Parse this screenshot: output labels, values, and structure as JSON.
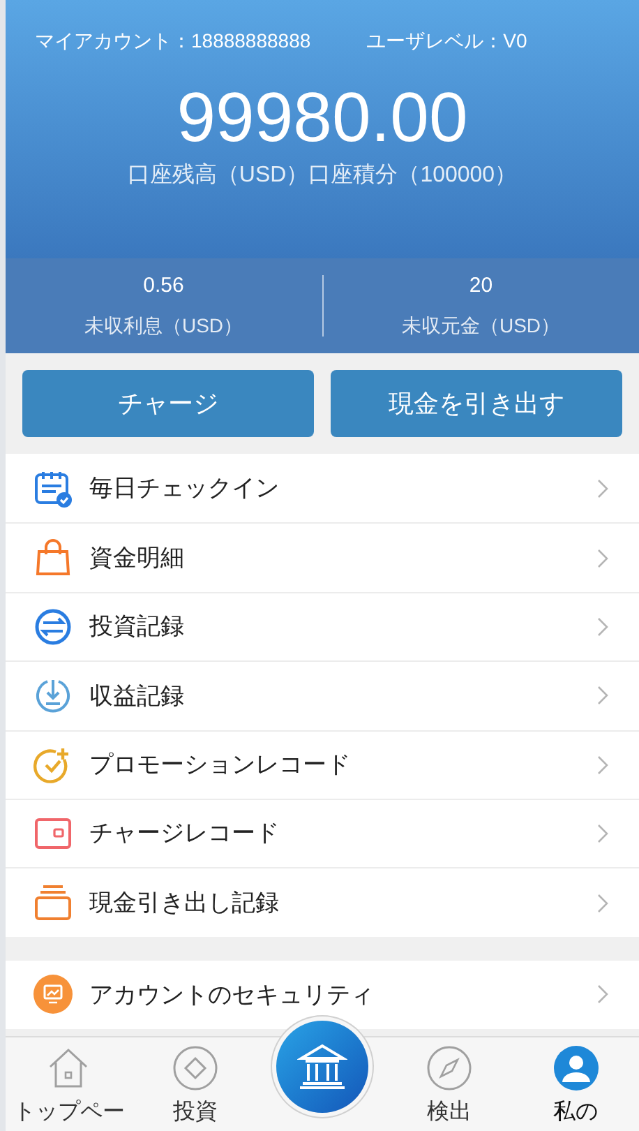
{
  "account": {
    "label": "マイアカウント：",
    "number": "18888888888",
    "level_label": "ユーザレベル：",
    "level": "V0"
  },
  "balance": {
    "amount": "99980.00",
    "caption": "口座残高（USD）口座積分（100000）"
  },
  "stats": [
    {
      "value": "0.56",
      "label": "未収利息（USD）"
    },
    {
      "value": "20",
      "label": "未収元金（USD）"
    }
  ],
  "actions": [
    "チャージ",
    "現金を引き出す"
  ],
  "menu_groups": [
    [
      {
        "label": "毎日チェックイン"
      },
      {
        "label": "資金明細"
      },
      {
        "label": "投資記録"
      },
      {
        "label": "収益記録"
      },
      {
        "label": "プロモーションレコード"
      },
      {
        "label": "チャージレコード"
      },
      {
        "label": "現金引き出し記録"
      }
    ],
    [
      {
        "label": "アカウントのセキュリティ"
      }
    ]
  ],
  "nav": [
    {
      "kind": "tab",
      "label": "トップペー",
      "selected": false
    },
    {
      "kind": "tab",
      "label": "投資",
      "selected": false
    },
    {
      "kind": "center"
    },
    {
      "kind": "tab",
      "label": "検出",
      "selected": false
    },
    {
      "kind": "tab",
      "label": "私の",
      "selected": true
    }
  ]
}
